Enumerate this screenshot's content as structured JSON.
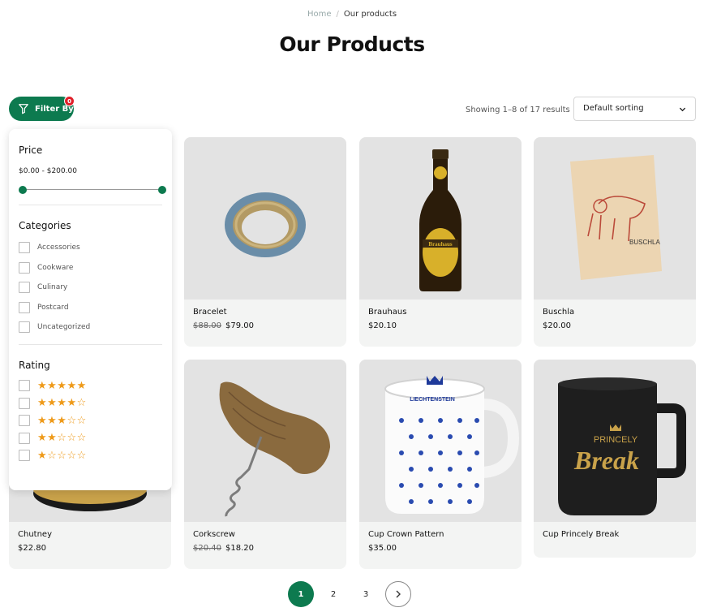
{
  "breadcrumb": {
    "home": "Home",
    "separator": "/",
    "current": "Our products"
  },
  "page_title": "Our Products",
  "filter_button": {
    "label": "Filter By",
    "badge": "0"
  },
  "result_count": "Showing 1–8 of 17 results",
  "sorting": {
    "selected": "Default sorting"
  },
  "filter_panel": {
    "price": {
      "heading": "Price",
      "range": "$0.00 - $200.00"
    },
    "categories": {
      "heading": "Categories",
      "items": [
        "Accessories",
        "Cookware",
        "Culinary",
        "Postcard",
        "Uncategorized"
      ]
    },
    "rating": {
      "heading": "Rating",
      "rows": [
        {
          "stars": "★★★★★",
          "value": 5
        },
        {
          "stars": "★★★★☆",
          "value": 4
        },
        {
          "stars": "★★★☆☆",
          "value": 3
        },
        {
          "stars": "★★☆☆☆",
          "value": 2
        },
        {
          "stars": "★☆☆☆☆",
          "value": 1
        }
      ]
    }
  },
  "products": [
    {
      "name": "Bracelet",
      "old_price": "$88.00",
      "price": "$79.00"
    },
    {
      "name": "Brauhaus",
      "old_price": "",
      "price": "$20.10"
    },
    {
      "name": "Buschla",
      "old_price": "",
      "price": "$20.00"
    },
    {
      "name": "Chutney",
      "old_price": "",
      "price": "$22.80"
    },
    {
      "name": "Corkscrew",
      "old_price": "$20.40",
      "price": "$18.20"
    },
    {
      "name": "Cup Crown Pattern",
      "old_price": "",
      "price": "$35.00"
    },
    {
      "name": "Cup Princely Break",
      "old_price": "",
      "price": ""
    }
  ],
  "product_image_text": {
    "brauhaus_label": "Brauhaus",
    "buschla_label": "BUSCHLA",
    "mug_crown_label": "LIECHTENSTEIN",
    "mug_break_top": "PRINCELY",
    "mug_break_main": "Break"
  },
  "pagination": {
    "pages": [
      "1",
      "2",
      "3"
    ],
    "current": "1",
    "next_icon": "chevron-right-icon"
  },
  "colors": {
    "accent": "#0d7a4f",
    "badge": "#e0202a",
    "star": "#ee9a1a"
  }
}
